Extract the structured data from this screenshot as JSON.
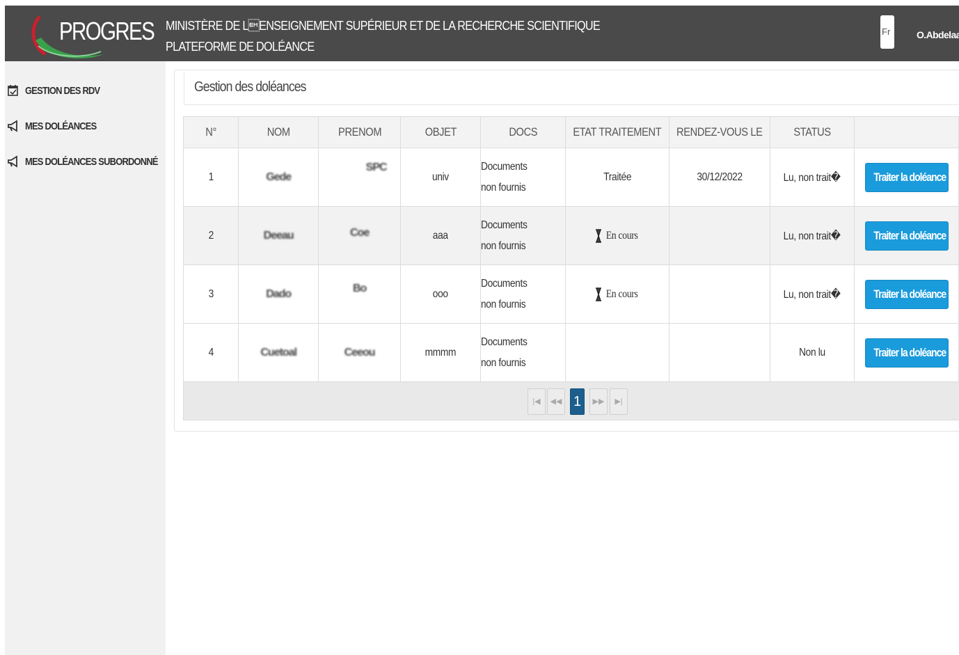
{
  "header": {
    "logo_text": "PROGRES",
    "title_line1": "MINISTÈRE DE L\u0019ENSEIGNEMENT SUPÉRIEUR ET DE LA RECHERCHE SCIENTIFIQUE",
    "title_line2": "PLATEFORME DE DOLÉANCE",
    "lang_label": "Fr",
    "user_name": "O.Abdelaazi"
  },
  "sidebar": {
    "items": [
      {
        "label": "GESTION DES RDV",
        "icon": "calendar-check-icon"
      },
      {
        "label": "MES DOLÉANCES",
        "icon": "megaphone-icon"
      },
      {
        "label": "MES DOLÉANCES SUBORDONNÉ",
        "icon": "megaphone-icon"
      }
    ]
  },
  "main": {
    "title": "Gestion des doléances",
    "columns": [
      "N°",
      "NOM",
      "PRENOM",
      "OBJET",
      "DOCS",
      "ETAT TRAITEMENT",
      "RENDEZ-VOUS LE",
      "STATUS",
      ""
    ],
    "rows": [
      {
        "num": "1",
        "nom": "Gede",
        "prenom": "SPC",
        "objet": "univ",
        "docs": "Documents non fournis",
        "etat": "Traitée",
        "etat_icon": "",
        "rdv": "30/12/2022",
        "status": "Lu, non trait�",
        "action": "Traiter la doléance"
      },
      {
        "num": "2",
        "nom": "Deeau",
        "prenom": "Coe",
        "objet": "aaa",
        "docs": "Documents non fournis",
        "etat": "En cours",
        "etat_icon": "hourglass-icon",
        "rdv": "",
        "status": "Lu, non trait�",
        "action": "Traiter la doléance"
      },
      {
        "num": "3",
        "nom": "Dado",
        "prenom": "Bo",
        "objet": "ooo",
        "docs": "Documents non fournis",
        "etat": "En cours",
        "etat_icon": "hourglass-icon",
        "rdv": "",
        "status": "Lu, non trait�",
        "action": "Traiter la doléance"
      },
      {
        "num": "4",
        "nom": "Cuetoal",
        "prenom": "Ceeou",
        "objet": "mmmm",
        "docs": "Documents non fournis",
        "etat": "",
        "etat_icon": "",
        "rdv": "",
        "status": "Non lu",
        "action": "Traiter la doléance"
      }
    ],
    "pagination": {
      "first": "|◀",
      "prev": "◀◀",
      "current": "1",
      "next": "▶▶",
      "last": "▶|"
    }
  },
  "colors": {
    "header_bg": "#4a4a4a",
    "sidebar_bg": "#f1f1f1",
    "button": "#1a9bdc",
    "page_active": "#1c5f8e",
    "logo_green": "#3aa14b",
    "logo_red": "#c8202f"
  }
}
